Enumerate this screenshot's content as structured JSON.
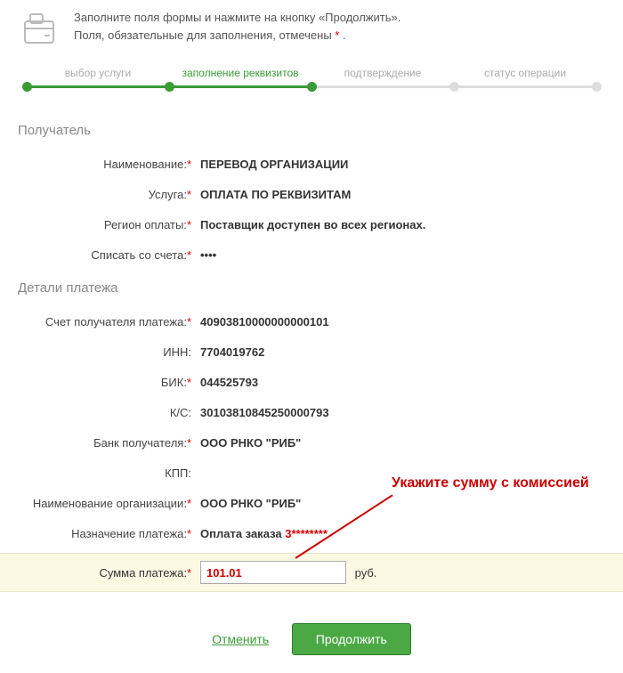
{
  "header": {
    "line1": "Заполните поля формы и нажмите на кнопку «Продолжить».",
    "line2": "Поля, обязательные для заполнения, отмечены ",
    "marker": "*",
    "line2_tail": " ."
  },
  "stepper": {
    "steps": [
      "выбор услуги",
      "заполнение реквизитов",
      "подтверждение",
      "статус операции"
    ],
    "active_index": 1
  },
  "sections": {
    "recipient": {
      "title": "Получатель",
      "rows": {
        "name_label": "Наименование:",
        "name_value": "ПЕРЕВОД ОРГАНИЗАЦИИ",
        "service_label": "Услуга:",
        "service_value": "ОПЛАТА ПО РЕКВИЗИТАМ",
        "region_label": "Регион оплаты:",
        "region_value": "Поставщик доступен во всех регионах.",
        "account_label": "Списать со счета:",
        "account_value": "••••"
      }
    },
    "details": {
      "title": "Детали платежа",
      "rows": {
        "recv_acc_label": "Счет получателя платежа:",
        "recv_acc_value": "40903810000000000101",
        "inn_label": "ИНН:",
        "inn_value": "7704019762",
        "bik_label": "БИК:",
        "bik_value": "044525793",
        "ks_label": "К/С:",
        "ks_value": "30103810845250000793",
        "bank_label": "Банк получателя:",
        "bank_value": "ООО РНКО \"РИБ\"",
        "kpp_label": "КПП:",
        "kpp_value": "",
        "org_label": "Наименование организации:",
        "org_value": "ООО РНКО \"РИБ\"",
        "purpose_label": "Назначение платежа:",
        "purpose_prefix": "Оплата заказа ",
        "purpose_masked": "3********",
        "amount_label": "Сумма платежа:",
        "amount_value": "101.01",
        "amount_currency": "руб."
      }
    }
  },
  "annotation": {
    "text": "Укажите сумму с комиссией"
  },
  "buttons": {
    "cancel": "Отменить",
    "continue": "Продолжить"
  }
}
